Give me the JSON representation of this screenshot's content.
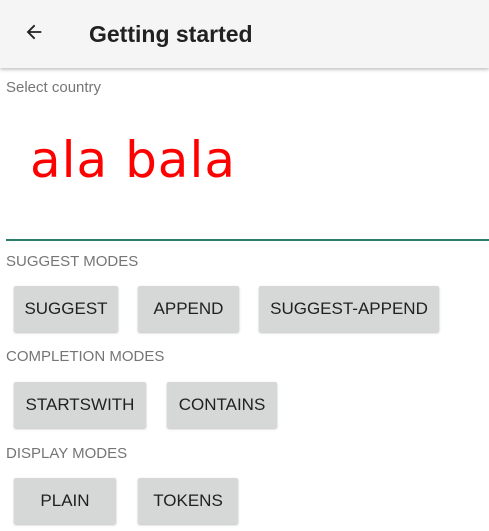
{
  "app_bar": {
    "title": "Getting started",
    "back_icon": "arrow-back-icon"
  },
  "country_field": {
    "label": "Select country",
    "value": "ala bala",
    "value_color": "#ff0000",
    "underline_color": "#2e7d6b"
  },
  "suggest_modes": {
    "header": "SUGGEST MODES",
    "buttons": [
      "SUGGEST",
      "APPEND",
      "SUGGEST-APPEND"
    ]
  },
  "completion_modes": {
    "header": "COMPLETION MODES",
    "buttons": [
      "STARTSWITH",
      "CONTAINS"
    ]
  },
  "display_modes": {
    "header": "DISPLAY MODES",
    "buttons": [
      "PLAIN",
      "TOKENS"
    ]
  }
}
